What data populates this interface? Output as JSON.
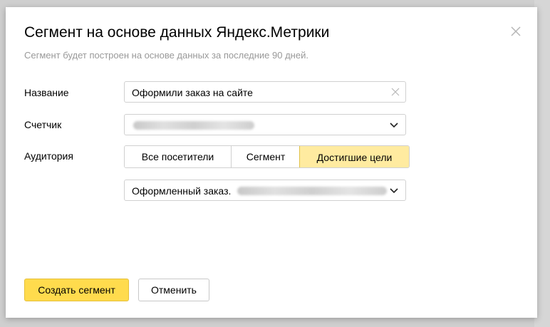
{
  "modal": {
    "title": "Сегмент на основе данных Яндекс.Метрики",
    "subtitle": "Сегмент будет построен на основе данных за последние 90 дней."
  },
  "form": {
    "name_label": "Название",
    "name_value": "Оформили заказ на сайте",
    "counter_label": "Счетчик",
    "audience_label": "Аудитория",
    "audience_options": [
      "Все посетители",
      "Сегмент",
      "Достигшие цели"
    ],
    "audience_selected": "Достигшие цели",
    "goal_value": "Оформленный заказ."
  },
  "buttons": {
    "create": "Создать сегмент",
    "cancel": "Отменить"
  },
  "colors": {
    "accent": "#ffdb4d",
    "selected_segment": "#ffeba0"
  }
}
